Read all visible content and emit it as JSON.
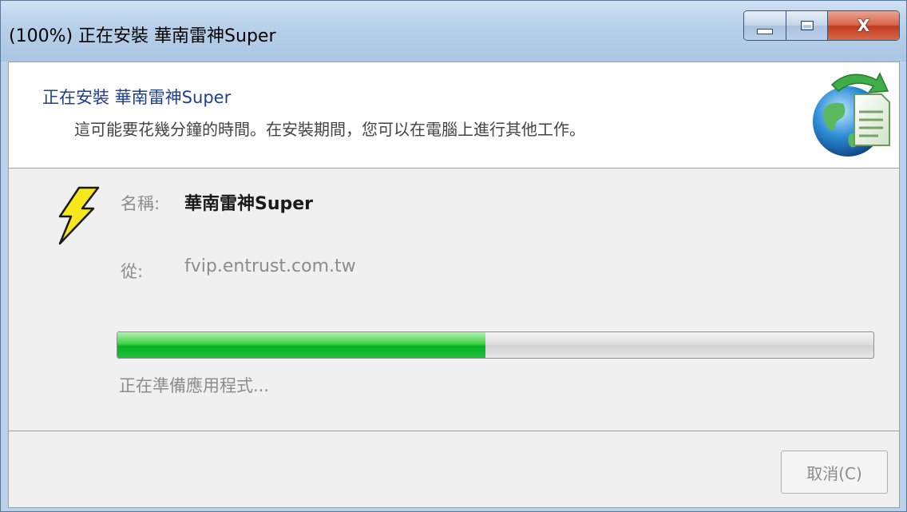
{
  "window": {
    "title": "(100%) 正在安裝 華南雷神Super",
    "caption_buttons": {
      "minimize_icon": "minimize-icon",
      "maximize_icon": "maximize-icon",
      "close_label": "X"
    }
  },
  "header": {
    "title": "正在安裝 華南雷神Super",
    "subtitle": "這可能要花幾分鐘的時間。在安裝期間，您可以在電腦上進行其他工作。",
    "icon": "globe-install-icon"
  },
  "details": {
    "app_icon": "lightning-bolt-icon",
    "name_label": "名稱:",
    "name_value": "華南雷神Super",
    "from_label": "從:",
    "from_value": "fvip.entrust.com.tw"
  },
  "progress": {
    "fraction": 0.487,
    "status": "正在準備應用程式..."
  },
  "footer": {
    "cancel_label": "取消(C)"
  },
  "colors": {
    "progress_green": "#06b025",
    "header_title": "#1f3f8f",
    "close_red": "#c23a1e"
  }
}
